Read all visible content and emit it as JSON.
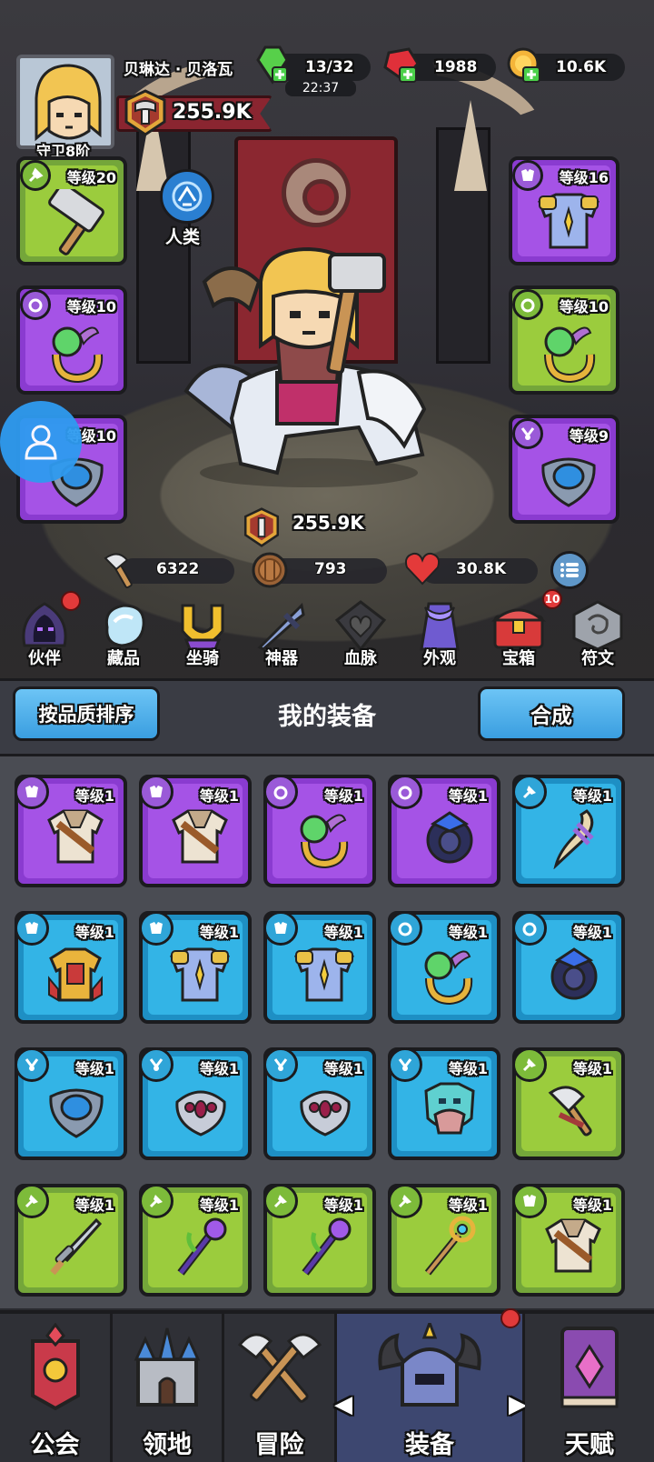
{
  "player": {
    "name": "贝琳达 · 贝洛瓦",
    "rank": "守卫8阶",
    "power": "255.9K",
    "race": "人类"
  },
  "resources": {
    "energy": "13/32",
    "energy_timer": "22:37",
    "gems": "1988",
    "gold": "10.6K"
  },
  "hero": {
    "power": "255.9K",
    "attack": "6322",
    "defense": "793",
    "hp": "30.8K"
  },
  "equipped_left": [
    {
      "level": "等级20",
      "slot": "weapon",
      "item": "hammer",
      "rarity": "green"
    },
    {
      "level": "等级10",
      "slot": "ring",
      "item": "orb-ring",
      "rarity": "purple"
    },
    {
      "level": "等级10",
      "slot": "amulet",
      "item": "blue-amulet",
      "rarity": "purple"
    }
  ],
  "equipped_right": [
    {
      "level": "等级16",
      "slot": "armor",
      "item": "plate-armor",
      "rarity": "purple"
    },
    {
      "level": "等级10",
      "slot": "ring",
      "item": "orb-ring",
      "rarity": "green"
    },
    {
      "level": "等级9",
      "slot": "amulet",
      "item": "blue-amulet",
      "rarity": "purple"
    }
  ],
  "functions": [
    {
      "label": "伙伴",
      "icon": "hood-icon",
      "badge": "dot"
    },
    {
      "label": "藏品",
      "icon": "crystal-icon",
      "badge": ""
    },
    {
      "label": "坐骑",
      "icon": "horseshoe-icon",
      "badge": ""
    },
    {
      "label": "神器",
      "icon": "sword-icon",
      "badge": ""
    },
    {
      "label": "血脉",
      "icon": "heart-crest-icon",
      "badge": ""
    },
    {
      "label": "外观",
      "icon": "cape-icon",
      "badge": ""
    },
    {
      "label": "宝箱",
      "icon": "chest-icon",
      "badge": "10"
    },
    {
      "label": "符文",
      "icon": "rune-icon",
      "badge": ""
    }
  ],
  "inventory": {
    "title": "我的装备",
    "sort_label": "按品质排序",
    "merge_label": "合成",
    "items": [
      {
        "level": "等级1",
        "slot": "armor",
        "item": "leather-vest",
        "rarity": "purple"
      },
      {
        "level": "等级1",
        "slot": "armor",
        "item": "leather-vest",
        "rarity": "purple"
      },
      {
        "level": "等级1",
        "slot": "ring",
        "item": "orb-ring",
        "rarity": "purple"
      },
      {
        "level": "等级1",
        "slot": "ring",
        "item": "dark-ring",
        "rarity": "purple"
      },
      {
        "level": "等级1",
        "slot": "weapon",
        "item": "claw-blade",
        "rarity": "blue"
      },
      {
        "level": "等级1",
        "slot": "armor",
        "item": "gold-armor",
        "rarity": "blue"
      },
      {
        "level": "等级1",
        "slot": "armor",
        "item": "plate-armor",
        "rarity": "blue"
      },
      {
        "level": "等级1",
        "slot": "armor",
        "item": "plate-armor",
        "rarity": "blue"
      },
      {
        "level": "等级1",
        "slot": "ring",
        "item": "orb-ring",
        "rarity": "blue"
      },
      {
        "level": "等级1",
        "slot": "ring",
        "item": "dark-ring",
        "rarity": "blue"
      },
      {
        "level": "等级1",
        "slot": "amulet",
        "item": "blue-amulet",
        "rarity": "blue"
      },
      {
        "level": "等级1",
        "slot": "amulet",
        "item": "spider-amulet",
        "rarity": "blue"
      },
      {
        "level": "等级1",
        "slot": "amulet",
        "item": "spider-amulet",
        "rarity": "blue"
      },
      {
        "level": "等级1",
        "slot": "amulet",
        "item": "skull-amulet",
        "rarity": "blue"
      },
      {
        "level": "等级1",
        "slot": "weapon",
        "item": "axe",
        "rarity": "green"
      },
      {
        "level": "等级1",
        "slot": "weapon",
        "item": "dagger",
        "rarity": "green"
      },
      {
        "level": "等级1",
        "slot": "weapon",
        "item": "staff",
        "rarity": "green"
      },
      {
        "level": "等级1",
        "slot": "weapon",
        "item": "staff",
        "rarity": "green"
      },
      {
        "level": "等级1",
        "slot": "weapon",
        "item": "gem-staff",
        "rarity": "green"
      },
      {
        "level": "等级1",
        "slot": "armor",
        "item": "leather-vest",
        "rarity": "green"
      }
    ]
  },
  "nav": [
    {
      "label": "公会",
      "icon": "guild-banner-icon",
      "active": false
    },
    {
      "label": "领地",
      "icon": "castle-icon",
      "active": false
    },
    {
      "label": "冒险",
      "icon": "crossed-axes-icon",
      "active": false
    },
    {
      "label": "装备",
      "icon": "helmet-icon",
      "active": true
    },
    {
      "label": "天赋",
      "icon": "spellbook-icon",
      "active": false
    }
  ],
  "colors": {
    "green_tile": "#9bcc3d",
    "purple_tile": "#a553e6",
    "blue_tile": "#33b4e6",
    "button_blue": "#3a9ee0",
    "badge_red": "#e23a3a"
  }
}
